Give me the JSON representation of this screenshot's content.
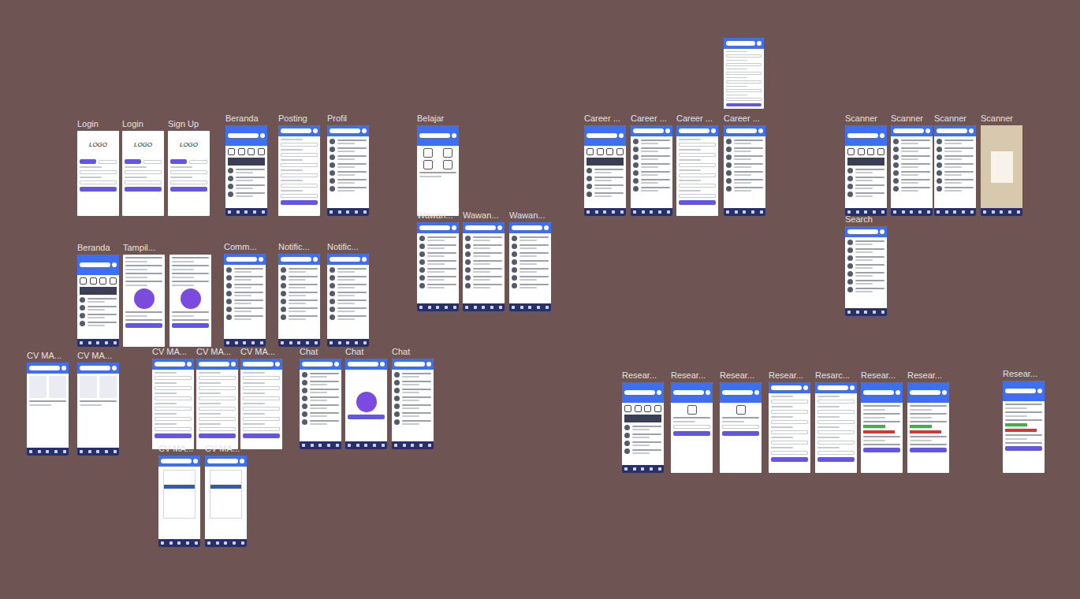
{
  "canvas": {
    "frames": [
      {
        "label": "Login",
        "kind": "login",
        "logo": "LOGO"
      },
      {
        "label": "Login",
        "kind": "login",
        "logo": "LOGO"
      },
      {
        "label": "Sign Up",
        "kind": "login",
        "logo": "LOGO"
      },
      {
        "label": "Beranda",
        "kind": "feed"
      },
      {
        "label": "Posting",
        "kind": "form"
      },
      {
        "label": "Profil",
        "kind": "list"
      },
      {
        "label": "Belajar",
        "kind": "menu"
      },
      {
        "label": "Wawan...",
        "kind": "list"
      },
      {
        "label": "Wawan...",
        "kind": "list"
      },
      {
        "label": "Wawan...",
        "kind": "list"
      },
      {
        "label": "Career ...",
        "kind": "feed"
      },
      {
        "label": "Career ...",
        "kind": "list"
      },
      {
        "label": "Career ...",
        "kind": "form"
      },
      {
        "label": "Career ...",
        "kind": "list"
      },
      {
        "label": "",
        "kind": "form"
      },
      {
        "label": "Scanner",
        "kind": "feed"
      },
      {
        "label": "Scanner",
        "kind": "list"
      },
      {
        "label": "Scanner",
        "kind": "list"
      },
      {
        "label": "Scanner",
        "kind": "photo"
      },
      {
        "label": "Search",
        "kind": "list"
      },
      {
        "label": "Beranda",
        "kind": "feed"
      },
      {
        "label": "Tampil...",
        "kind": "doc"
      },
      {
        "label": "",
        "kind": "doc"
      },
      {
        "label": "Comm...",
        "kind": "list"
      },
      {
        "label": "Notific...",
        "kind": "list"
      },
      {
        "label": "Notific...",
        "kind": "list"
      },
      {
        "label": "CV MA...",
        "kind": "cvgrid"
      },
      {
        "label": "CV MA...",
        "kind": "cvgrid"
      },
      {
        "label": "CV MA...",
        "kind": "form"
      },
      {
        "label": "CV MA...",
        "kind": "form"
      },
      {
        "label": "CV MA...",
        "kind": "form"
      },
      {
        "label": "Chat",
        "kind": "list"
      },
      {
        "label": "Chat",
        "kind": "empty"
      },
      {
        "label": "Chat",
        "kind": "list"
      },
      {
        "label": "CV MA...",
        "kind": "cvview"
      },
      {
        "label": "CV MA...",
        "kind": "cvview"
      },
      {
        "label": "Resear...",
        "kind": "feed"
      },
      {
        "label": "Resear...",
        "kind": "survey"
      },
      {
        "label": "Resear...",
        "kind": "survey"
      },
      {
        "label": "Resear...",
        "kind": "form"
      },
      {
        "label": "Resarc...",
        "kind": "form"
      },
      {
        "label": "Resear...",
        "kind": "chart"
      },
      {
        "label": "Resear...",
        "kind": "chart"
      },
      {
        "label": "Resear...",
        "kind": "chart"
      }
    ]
  }
}
